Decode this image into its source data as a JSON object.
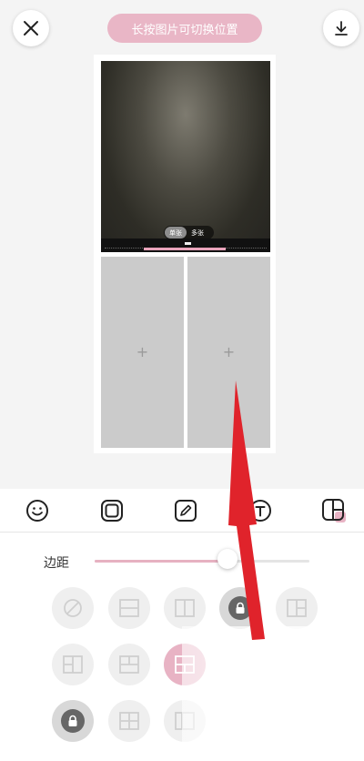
{
  "header": {
    "hint": "长按图片可切换位置",
    "close_icon": "close-icon",
    "download_icon": "download-icon"
  },
  "photo_toggle": {
    "option_on": "单张",
    "option_off": "多张"
  },
  "empty_cells": [
    {
      "plus": "+"
    },
    {
      "plus": "+"
    }
  ],
  "toolbar": {
    "tools": [
      "smiley-icon",
      "frame-icon",
      "pen-icon",
      "text-icon",
      "layout-icon"
    ]
  },
  "margin": {
    "label": "边距",
    "value": 0.62
  },
  "layouts": [
    {
      "icon": "no-layout-icon",
      "state": "normal"
    },
    {
      "icon": "split-horizontal-icon",
      "state": "normal"
    },
    {
      "icon": "split-vertical-icon",
      "state": "normal"
    },
    {
      "icon": "lock-icon",
      "state": "locked"
    },
    {
      "icon": "grid-t-icon",
      "state": "normal"
    },
    {
      "icon": "grid-left-big-icon",
      "state": "normal"
    },
    {
      "icon": "grid-top-split-icon",
      "state": "normal"
    },
    {
      "icon": "grid-selected-icon",
      "state": "selected"
    },
    {
      "icon": "lock-icon",
      "state": "locked"
    },
    {
      "icon": "grid-four-icon",
      "state": "normal"
    },
    {
      "icon": "grid-partial-icon",
      "state": "normal"
    }
  ],
  "colors": {
    "accent_pink": "#e8b3c4",
    "arrow_red": "#e0232b"
  }
}
